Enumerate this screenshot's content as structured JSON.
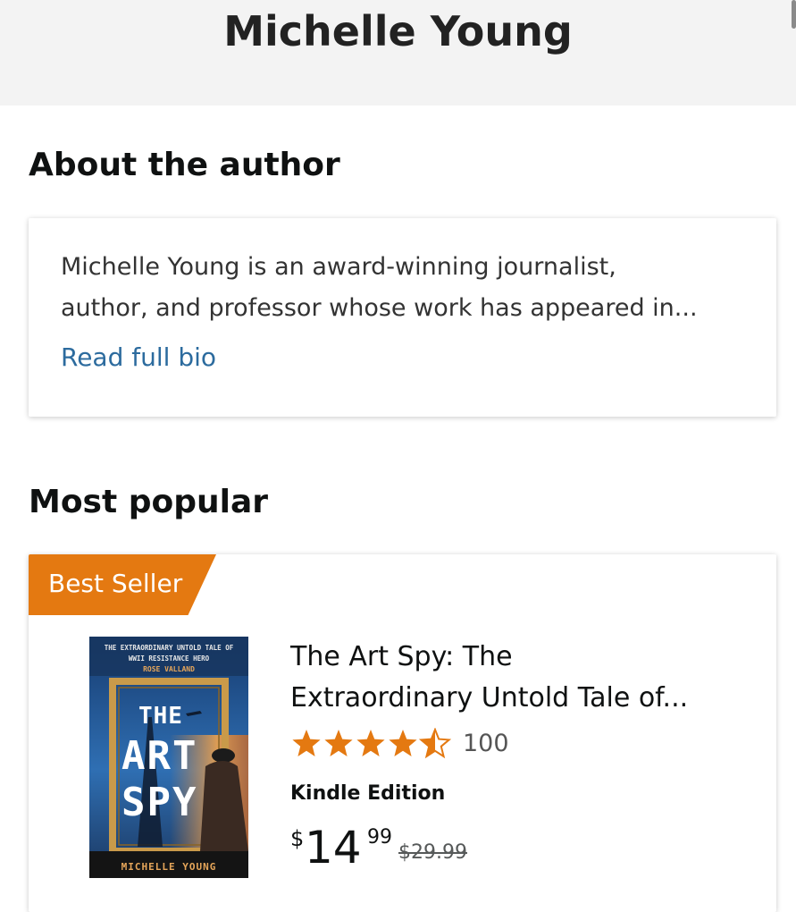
{
  "header": {
    "title": "Michelle Young"
  },
  "about": {
    "heading": "About the author",
    "bio_line1": "Michelle Young is an award-winning journalist,",
    "bio_line2": "author, and professor whose work has appeared in...",
    "read_more": "Read full bio"
  },
  "popular": {
    "heading": "Most popular",
    "items": [
      {
        "badge": "Best Seller",
        "cover": {
          "tagline1": "THE EXTRAORDINARY UNTOLD TALE OF",
          "tagline2": "WWII RESISTANCE HERO",
          "tagline3": "ROSE VALLAND",
          "title1": "THE",
          "title2": "ART",
          "title3": "SPY",
          "author": "MICHELLE YOUNG"
        },
        "title_line1": "The Art Spy: The",
        "title_line2": "Extraordinary Untold Tale of...",
        "rating": 4.5,
        "rating_max": 5,
        "review_count": "100",
        "format": "Kindle Edition",
        "price_symbol": "$",
        "price_whole": "14",
        "price_fraction": "99",
        "list_price": "$29.99"
      }
    ]
  },
  "colors": {
    "badge": "#e47911",
    "link": "#2c6b9e",
    "star": "#e47911",
    "header_bg": "#f3f3f3"
  }
}
